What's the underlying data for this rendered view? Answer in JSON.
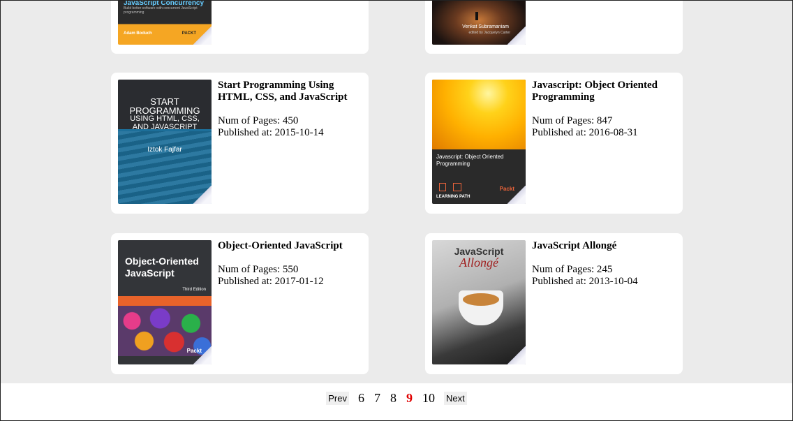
{
  "books": [
    {
      "id": "top-left",
      "cover": {
        "line1": "JavaScript Concurrency",
        "line2": "Adam Boduch",
        "publisher": "PACKT"
      }
    },
    {
      "id": "top-right",
      "cover": {
        "line1": "Venkat Subramaniam",
        "line2": "edited by Jacquelyn Carter"
      }
    },
    {
      "id": "start-programming",
      "title": "Start Programming Using HTML, CSS, and JavaScript",
      "pages_label": "Num of Pages: 450",
      "published_label": "Published at: 2015-10-14",
      "cover": {
        "line1": "START",
        "line2": "PROGRAMMING",
        "line3": "USING HTML, CSS,",
        "line4": "AND JAVASCRIPT",
        "author": "Iztok Fajfar"
      }
    },
    {
      "id": "js-oop",
      "title": "Javascript: Object Oriented Programming",
      "pages_label": "Num of Pages: 847",
      "published_label": "Published at: 2016-08-31",
      "cover": {
        "line1": "Javascript: Object Oriented",
        "line2": "Programming",
        "footer": "LEARNING PATH",
        "publisher": "Packt"
      }
    },
    {
      "id": "oo-javascript",
      "title": "Object-Oriented JavaScript",
      "pages_label": "Num of Pages: 550",
      "published_label": "Published at: 2017-01-12",
      "cover": {
        "line1": "Object-Oriented",
        "line2": "JavaScript",
        "edition": "Third Edition",
        "publisher": "Packt"
      }
    },
    {
      "id": "js-allonge",
      "title": "JavaScript Allongé",
      "pages_label": "Num of Pages: 245",
      "published_label": "Published at: 2013-10-04",
      "cover": {
        "line1": "JavaScript",
        "line2": "Allongé"
      }
    }
  ],
  "pagination": {
    "prev_label": "Prev",
    "next_label": "Next",
    "pages": [
      "6",
      "7",
      "8",
      "9",
      "10"
    ],
    "current": "9"
  },
  "colors": {
    "page_bg": "#ebebeb",
    "card_bg": "#ffffff",
    "active_page": "#e00000"
  }
}
